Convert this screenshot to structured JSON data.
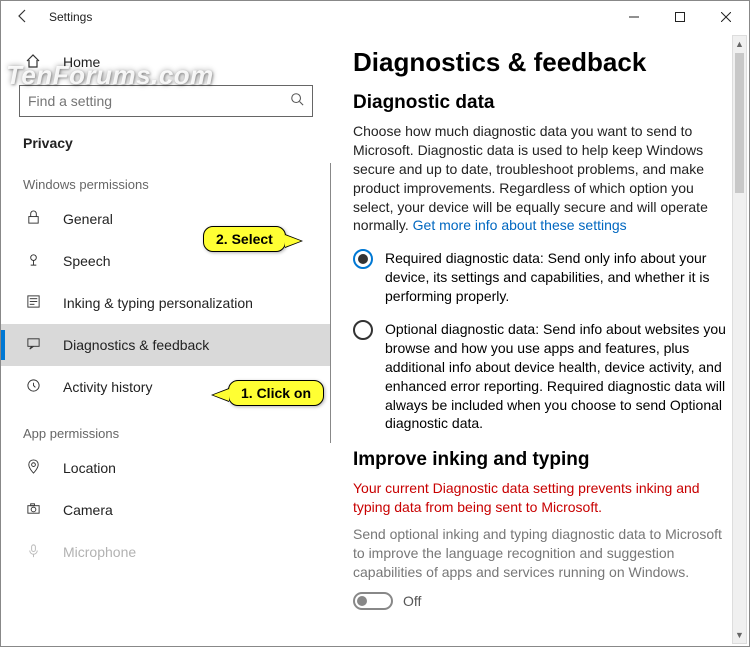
{
  "titlebar": {
    "title": "Settings"
  },
  "sidebar": {
    "home": "Home",
    "search_placeholder": "Find a setting",
    "category": "Privacy",
    "group1_label": "Windows permissions",
    "group1": [
      {
        "icon": "lock-icon",
        "label": "General"
      },
      {
        "icon": "speech-icon",
        "label": "Speech"
      },
      {
        "icon": "inking-icon",
        "label": "Inking & typing personalization"
      },
      {
        "icon": "feedback-icon",
        "label": "Diagnostics & feedback"
      },
      {
        "icon": "history-icon",
        "label": "Activity history"
      }
    ],
    "group2_label": "App permissions",
    "group2": [
      {
        "icon": "location-icon",
        "label": "Location"
      },
      {
        "icon": "camera-icon",
        "label": "Camera"
      },
      {
        "icon": "mic-icon",
        "label": "Microphone"
      }
    ]
  },
  "main": {
    "title": "Diagnostics & feedback",
    "section1_title": "Diagnostic data",
    "section1_desc": "Choose how much diagnostic data you want to send to Microsoft. Diagnostic data is used to help keep Windows secure and up to date, troubleshoot problems, and make product improvements. Regardless of which option you select, your device will be equally secure and will operate normally. ",
    "section1_link": "Get more info about these settings",
    "radio1": "Required diagnostic data: Send only info about your device, its settings and capabilities, and whether it is performing properly.",
    "radio2": "Optional diagnostic data: Send info about websites you browse and how you use apps and features, plus additional info about device health, device activity, and enhanced error reporting. Required diagnostic data will always be included when you choose to send Optional diagnostic data.",
    "section2_title": "Improve inking and typing",
    "warning": "Your current Diagnostic data setting prevents inking and typing data from being sent to Microsoft.",
    "section2_desc": "Send optional inking and typing diagnostic data to Microsoft to improve the language recognition and suggestion capabilities of apps and services running on Windows.",
    "toggle_label": "Off"
  },
  "callouts": {
    "c1": "1. Click on",
    "c2": "2. Select"
  },
  "watermark": "TenForums.com"
}
